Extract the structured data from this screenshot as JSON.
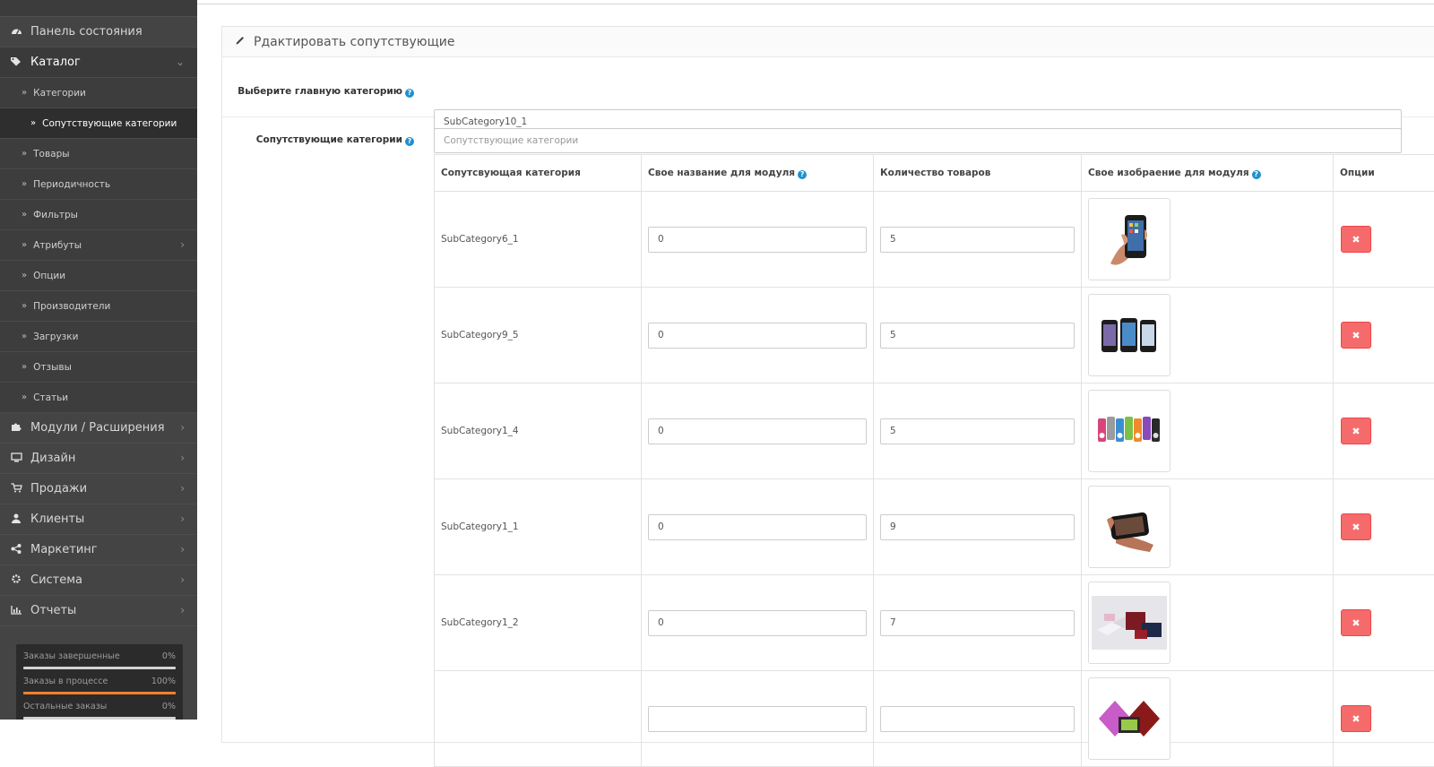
{
  "sidebar": {
    "menu_top": [
      {
        "label": "Панель состояния",
        "icon": "dashboard-icon"
      },
      {
        "label": "Каталог",
        "icon": "tags-icon"
      }
    ],
    "catalog_items": [
      {
        "label": "Категории"
      },
      {
        "label": "Сопутствующие категории"
      },
      {
        "label": "Товары"
      },
      {
        "label": "Периодичность"
      },
      {
        "label": "Фильтры"
      },
      {
        "label": "Атрибуты"
      },
      {
        "label": "Опции"
      },
      {
        "label": "Производители"
      },
      {
        "label": "Загрузки"
      },
      {
        "label": "Отзывы"
      },
      {
        "label": "Статьи"
      }
    ],
    "menu_bottom": [
      {
        "label": "Модули / Расширения",
        "icon": "puzzle-icon"
      },
      {
        "label": "Дизайн",
        "icon": "monitor-icon"
      },
      {
        "label": "Продажи",
        "icon": "cart-icon"
      },
      {
        "label": "Клиенты",
        "icon": "user-icon"
      },
      {
        "label": "Маркетинг",
        "icon": "share-icon"
      },
      {
        "label": "Система",
        "icon": "cog-icon"
      },
      {
        "label": "Отчеты",
        "icon": "bar-chart-icon"
      }
    ],
    "stats": [
      {
        "label": "Заказы завершенные",
        "value": "0%",
        "progress": 0,
        "color": "#ffffff"
      },
      {
        "label": "Заказы в процессе",
        "value": "100%",
        "progress": 1.0,
        "color": "#f0812f"
      },
      {
        "label": "Остальные заказы",
        "value": "0%",
        "progress": 0,
        "color": "#ffffff"
      }
    ]
  },
  "panel": {
    "title": "Рдактировать сопутствующие",
    "main_category_label": "Выберите главную категорию",
    "main_category_value": "SubCategory10_1",
    "related_label": "Сопутствующие категории",
    "related_placeholder": "Сопутствующие категории"
  },
  "table": {
    "headers": {
      "category": "Сопутсвующая категория",
      "name": "Свое название для модуля",
      "count": "Количество товаров",
      "image": "Свое изобраение для модуля",
      "options": "Опции"
    },
    "rows": [
      {
        "category": "SubCategory6_1",
        "name": "0",
        "count": "5",
        "image": "iphone-in-hand"
      },
      {
        "category": "SubCategory9_5",
        "name": "0",
        "count": "5",
        "image": "three-phones"
      },
      {
        "category": "SubCategory1_4",
        "name": "0",
        "count": "5",
        "image": "ipod-nano-row"
      },
      {
        "category": "SubCategory1_1",
        "name": "0",
        "count": "9",
        "image": "ipod-touch-hand"
      },
      {
        "category": "SubCategory1_2",
        "name": "0",
        "count": "7",
        "image": "laptops"
      },
      {
        "category": "",
        "name": "",
        "count": "",
        "image": "colorful-laptops"
      }
    ]
  },
  "colors": {
    "sidebar_bg": "#444444",
    "help_blue": "#1e91cf",
    "delete_red": "#f56b6b"
  }
}
